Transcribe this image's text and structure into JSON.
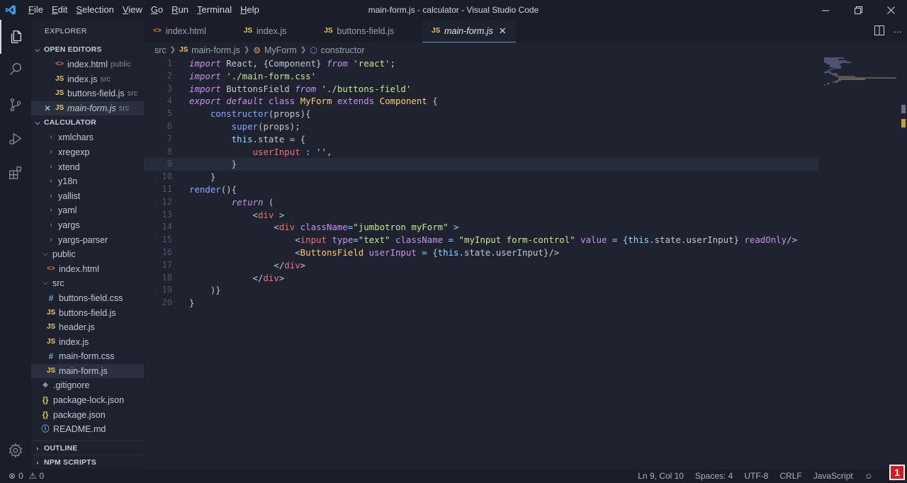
{
  "window": {
    "title": "main-form.js - calculator - Visual Studio Code",
    "menu": [
      "File",
      "Edit",
      "Selection",
      "View",
      "Go",
      "Run",
      "Terminal",
      "Help"
    ],
    "menu_mnemonics": [
      "F",
      "E",
      "S",
      "V",
      "G",
      "R",
      "T",
      "H"
    ]
  },
  "sidebar": {
    "title": "EXPLORER",
    "open_editors_label": "OPEN EDITORS",
    "open_editors": [
      {
        "name": "index.html",
        "desc": "public",
        "type": "html"
      },
      {
        "name": "index.js",
        "desc": "src",
        "type": "js"
      },
      {
        "name": "buttons-field.js",
        "desc": "src",
        "type": "js"
      },
      {
        "name": "main-form.js",
        "desc": "src",
        "type": "js",
        "active": true
      }
    ],
    "project_label": "CALCULATOR",
    "tree": [
      {
        "name": "xmlchars",
        "kind": "folder",
        "depth": 2
      },
      {
        "name": "xregexp",
        "kind": "folder",
        "depth": 2
      },
      {
        "name": "xtend",
        "kind": "folder",
        "depth": 2
      },
      {
        "name": "y18n",
        "kind": "folder",
        "depth": 2
      },
      {
        "name": "yallist",
        "kind": "folder",
        "depth": 2
      },
      {
        "name": "yaml",
        "kind": "folder",
        "depth": 2
      },
      {
        "name": "yargs",
        "kind": "folder",
        "depth": 2
      },
      {
        "name": "yargs-parser",
        "kind": "folder",
        "depth": 2
      },
      {
        "name": "public",
        "kind": "folder",
        "depth": 1
      },
      {
        "name": "index.html",
        "kind": "html",
        "depth": 2
      },
      {
        "name": "src",
        "kind": "folder",
        "depth": 1
      },
      {
        "name": "buttons-field.css",
        "kind": "css",
        "depth": 2
      },
      {
        "name": "buttons-field.js",
        "kind": "js",
        "depth": 2
      },
      {
        "name": "header.js",
        "kind": "js",
        "depth": 2
      },
      {
        "name": "index.js",
        "kind": "js",
        "depth": 2
      },
      {
        "name": "main-form.css",
        "kind": "css",
        "depth": 2
      },
      {
        "name": "main-form.js",
        "kind": "js",
        "depth": 2,
        "selected": true
      },
      {
        "name": ".gitignore",
        "kind": "git",
        "depth": 1
      },
      {
        "name": "package-lock.json",
        "kind": "json",
        "depth": 1
      },
      {
        "name": "package.json",
        "kind": "json",
        "depth": 1
      },
      {
        "name": "README.md",
        "kind": "info",
        "depth": 1
      }
    ],
    "outline_label": "OUTLINE",
    "npm_label": "NPM SCRIPTS"
  },
  "tabs": [
    {
      "name": "index.html",
      "type": "html"
    },
    {
      "name": "index.js",
      "type": "js"
    },
    {
      "name": "buttons-field.js",
      "type": "js"
    },
    {
      "name": "main-form.js",
      "type": "js",
      "active": true
    }
  ],
  "breadcrumb": {
    "folder": "src",
    "file": "main-form.js",
    "class": "MyForm",
    "method": "constructor"
  },
  "code": {
    "current_line": 9,
    "lines": [
      [
        [
          "kw",
          "import"
        ],
        [
          "pl",
          " React, {Component} "
        ],
        [
          "kw",
          "from"
        ],
        [
          "pl",
          " "
        ],
        [
          "st",
          "'react'"
        ],
        [
          "pl",
          ";"
        ]
      ],
      [
        [
          "kw",
          "import"
        ],
        [
          "pl",
          " "
        ],
        [
          "st",
          "'./main-form.css'"
        ]
      ],
      [
        [
          "kw",
          "import"
        ],
        [
          "pl",
          " ButtonsField "
        ],
        [
          "kw",
          "from"
        ],
        [
          "pl",
          " "
        ],
        [
          "st",
          "'./buttons-field'"
        ]
      ],
      [
        [
          "kw",
          "export"
        ],
        [
          "pl",
          " "
        ],
        [
          "kw",
          "default"
        ],
        [
          "pl",
          " "
        ],
        [
          "kw2",
          "class"
        ],
        [
          "pl",
          " "
        ],
        [
          "cl",
          "MyForm"
        ],
        [
          "pl",
          " "
        ],
        [
          "kw2",
          "extends"
        ],
        [
          "pl",
          " "
        ],
        [
          "cl",
          "Component"
        ],
        [
          "pl",
          " {"
        ]
      ],
      [
        [
          "pl",
          "    "
        ],
        [
          "fn",
          "constructor"
        ],
        [
          "pl",
          "(props){"
        ]
      ],
      [
        [
          "pl",
          "        "
        ],
        [
          "fn",
          "super"
        ],
        [
          "pl",
          "(props);"
        ]
      ],
      [
        [
          "pl",
          "        "
        ],
        [
          "th",
          "this"
        ],
        [
          "pl",
          ".state = {"
        ]
      ],
      [
        [
          "pl",
          "            "
        ],
        [
          "pr",
          "userInput"
        ],
        [
          "pl",
          " "
        ],
        [
          "pn",
          ":"
        ],
        [
          "pl",
          " "
        ],
        [
          "st",
          "''"
        ],
        [
          "pl",
          ","
        ]
      ],
      [
        [
          "pl",
          "        }"
        ]
      ],
      [
        [
          "pl",
          "    }"
        ]
      ],
      [
        [
          "fn",
          "render"
        ],
        [
          "pl",
          "(){"
        ]
      ],
      [
        [
          "pl",
          "        "
        ],
        [
          "kw",
          "return"
        ],
        [
          "pl",
          " ("
        ]
      ],
      [
        [
          "pl",
          "            <"
        ],
        [
          "tg",
          "div"
        ],
        [
          "pl",
          " >"
        ]
      ],
      [
        [
          "pl",
          "                <"
        ],
        [
          "tg",
          "div"
        ],
        [
          "pl",
          " "
        ],
        [
          "at",
          "className"
        ],
        [
          "pn",
          "="
        ],
        [
          "st",
          "\"jumbotron myForm\""
        ],
        [
          "pl",
          " >"
        ]
      ],
      [
        [
          "pl",
          "                    <"
        ],
        [
          "tg",
          "input"
        ],
        [
          "pl",
          " "
        ],
        [
          "at",
          "type"
        ],
        [
          "pn",
          "="
        ],
        [
          "st",
          "\"text\""
        ],
        [
          "pl",
          " "
        ],
        [
          "at",
          "className"
        ],
        [
          "pl",
          " "
        ],
        [
          "pn",
          "="
        ],
        [
          "pl",
          " "
        ],
        [
          "st",
          "\"myInput form-control\""
        ],
        [
          "pl",
          " "
        ],
        [
          "at",
          "value"
        ],
        [
          "pl",
          " "
        ],
        [
          "pn",
          "="
        ],
        [
          "pl",
          " {"
        ],
        [
          "th",
          "this"
        ],
        [
          "pl",
          ".state.userInput} "
        ],
        [
          "at",
          "readOnly"
        ],
        [
          "pl",
          "/>"
        ]
      ],
      [
        [
          "pl",
          "                    <"
        ],
        [
          "cl",
          "ButtonsField"
        ],
        [
          "pl",
          " "
        ],
        [
          "at",
          "userInput"
        ],
        [
          "pl",
          " "
        ],
        [
          "pn",
          "="
        ],
        [
          "pl",
          " {"
        ],
        [
          "th",
          "this"
        ],
        [
          "pl",
          ".state.userInput}/>"
        ]
      ],
      [
        [
          "pl",
          "                </"
        ],
        [
          "tg",
          "div"
        ],
        [
          "pl",
          ">"
        ]
      ],
      [
        [
          "pl",
          "            </"
        ],
        [
          "tg",
          "div"
        ],
        [
          "pl",
          ">"
        ]
      ],
      [
        [
          "pl",
          "    )}"
        ]
      ],
      [
        [
          "pl",
          "}"
        ]
      ]
    ]
  },
  "statusbar": {
    "errors": "0",
    "warnings": "0",
    "position": "Ln 9, Col 10",
    "spaces": "Spaces: 4",
    "encoding": "UTF-8",
    "eol": "CRLF",
    "language": "JavaScript"
  },
  "colors": {
    "accent": "#5d9bd4",
    "keyword": "#c792ea",
    "string": "#c3e88d",
    "class": "#ffcb6b",
    "function": "#82aaff",
    "tag": "#f07178"
  }
}
